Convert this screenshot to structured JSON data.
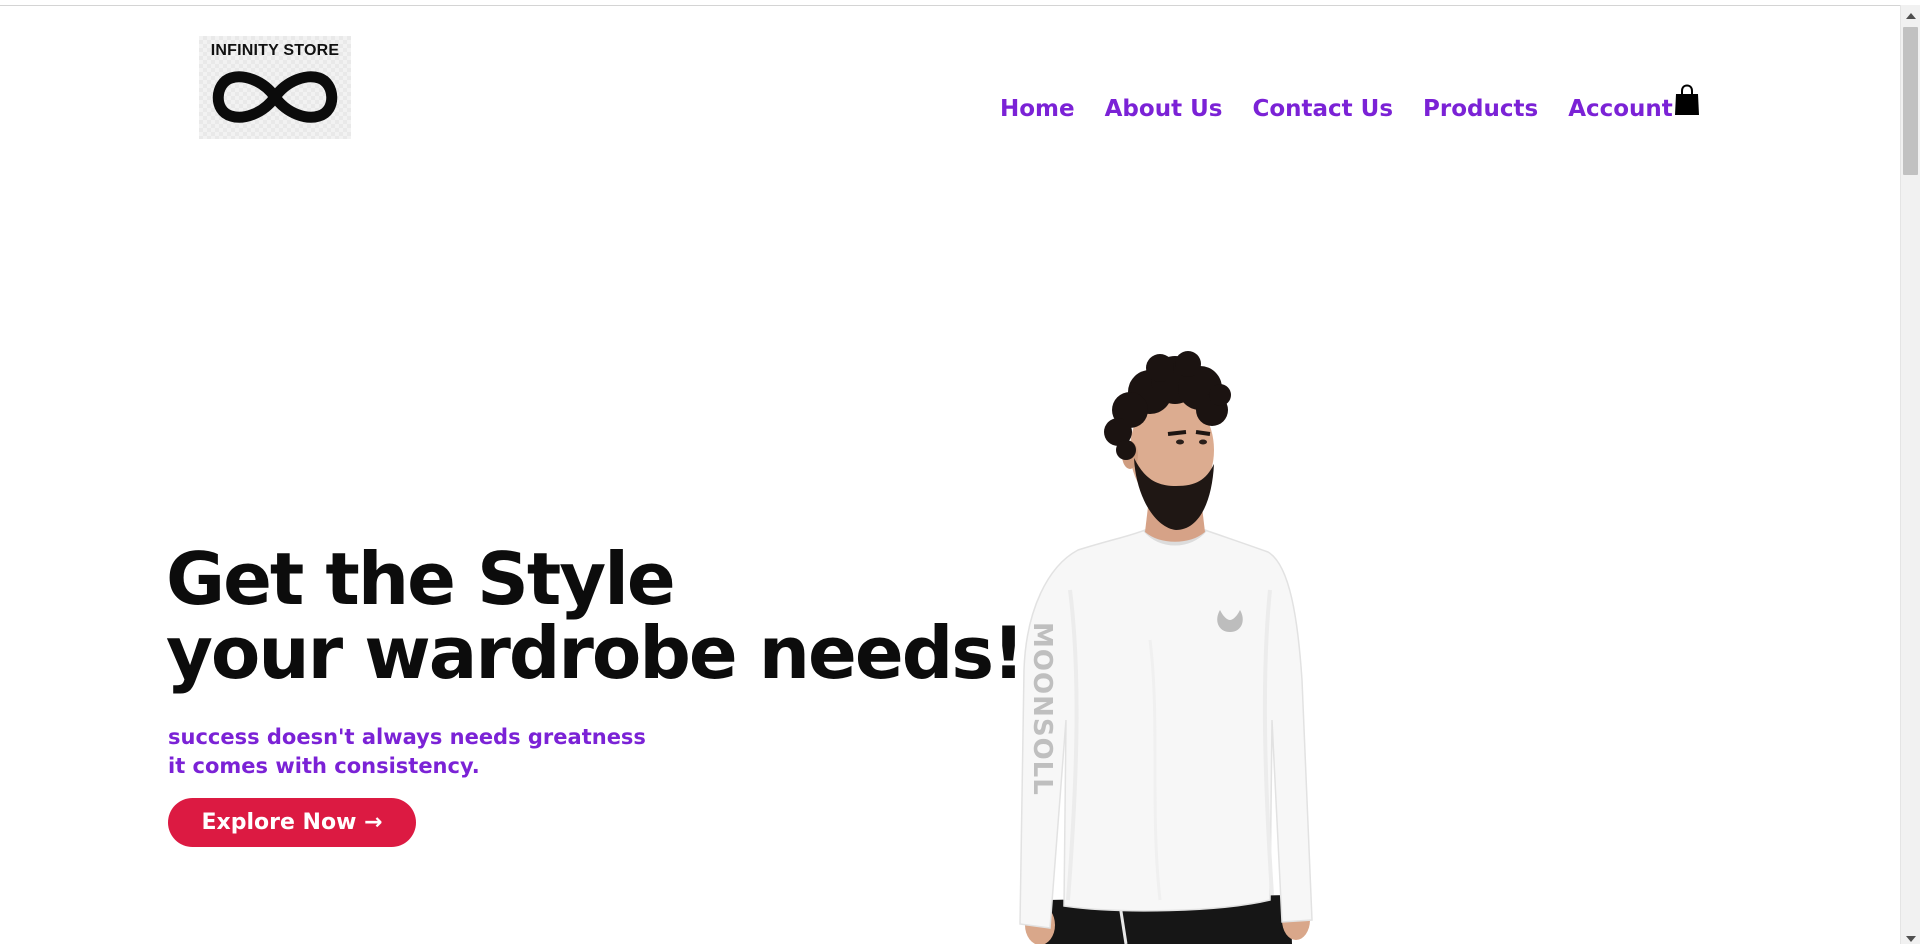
{
  "logo": {
    "text": "INFINITY STORE",
    "symbol_icon": "infinity-icon"
  },
  "nav": {
    "items": [
      {
        "label": "Home"
      },
      {
        "label": "About Us"
      },
      {
        "label": "Contact Us"
      },
      {
        "label": "Products"
      },
      {
        "label": "Account"
      }
    ],
    "cart_icon": "shopping-bag-icon"
  },
  "hero": {
    "title_line1": "Get the Style",
    "title_line2": "your wardrobe needs!",
    "subtitle_line1": "success doesn't always needs greatness",
    "subtitle_line2": "it comes with consistency.",
    "button_label": "Explore Now →",
    "sleeve_print": "MOONSOLL"
  },
  "colors": {
    "nav_text": "#7b22d6",
    "title_text": "#0c0c0c",
    "subtitle_text": "#7b22d6",
    "button_bg": "#dc1a42",
    "button_text": "#ffffff",
    "background": "#ffffff"
  }
}
